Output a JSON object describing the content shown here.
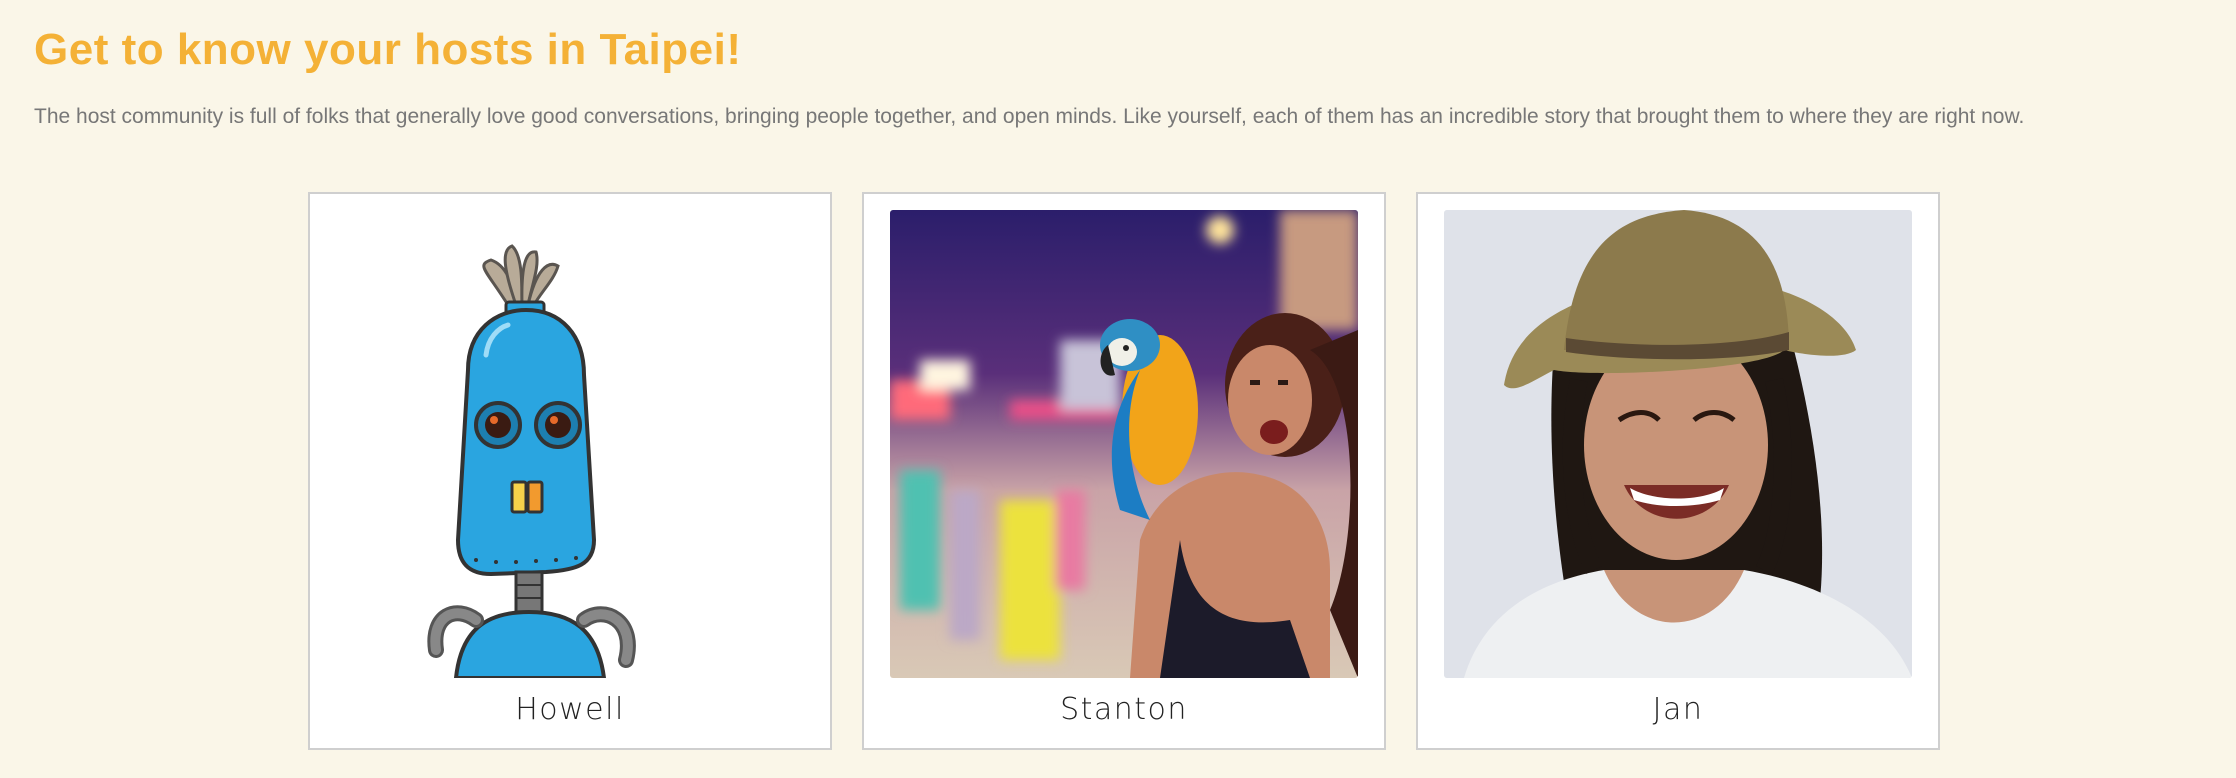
{
  "header": {
    "title": "Get to know your hosts in Taipei!",
    "intro": "The host community is full of folks that generally love good conversations, bringing people together, and open minds. Like yourself, each of them has an incredible story that brought them to where they are right now."
  },
  "colors": {
    "background": "#faf6e8",
    "title": "#f4b136",
    "intro_text": "#777777",
    "card_border": "#cfcfcf"
  },
  "hosts": [
    {
      "name": "Howell",
      "avatar": "robot-avatar-illustration"
    },
    {
      "name": "Stanton",
      "avatar": "photo-woman-with-parrot-night-market"
    },
    {
      "name": "Jan",
      "avatar": "photo-smiling-woman-in-hat"
    }
  ]
}
